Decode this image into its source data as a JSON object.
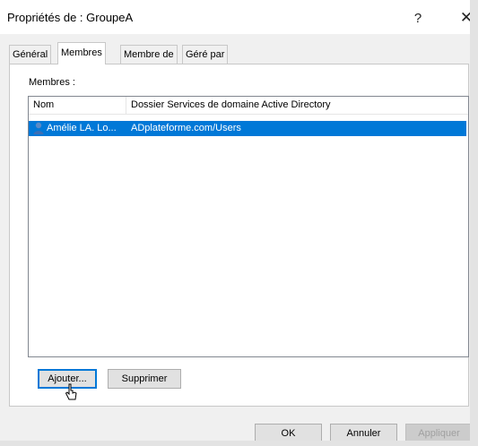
{
  "window": {
    "title": "Propriétés de : GroupeA",
    "help": "?",
    "close": "✕"
  },
  "tabs": [
    "Général",
    "Membres",
    "Membre de",
    "Géré par"
  ],
  "panel": {
    "members_label": "Membres :"
  },
  "columns": [
    "Nom",
    "Dossier Services de domaine Active Directory"
  ],
  "rows": [
    {
      "name": "Amélie LA. Lo...",
      "folder": "ADplateforme.com/Users",
      "selected": true
    }
  ],
  "buttons": {
    "add": "Ajouter...",
    "remove": "Supprimer",
    "ok": "OK",
    "cancel": "Annuler",
    "apply": "Appliquer"
  },
  "colors": {
    "selection": "#0078d7",
    "focus_border": "#0078d7"
  },
  "icons": {
    "user": "user-icon",
    "cursor": "mouse-pointer-icon"
  }
}
